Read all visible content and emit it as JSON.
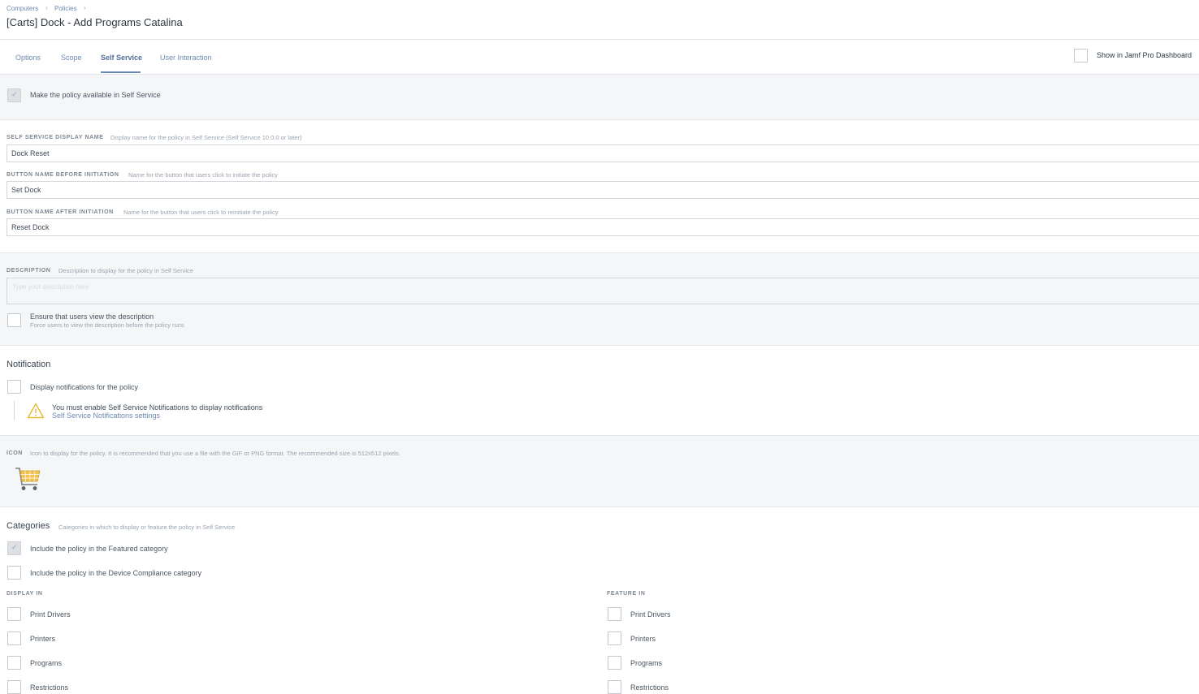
{
  "breadcrumb": {
    "items": [
      "Computers",
      "Policies"
    ],
    "separator": "›"
  },
  "page_title": "[Carts] Dock - Add Programs Catalina",
  "tabs": [
    {
      "label": "Options",
      "active": false
    },
    {
      "label": "Scope",
      "active": false
    },
    {
      "label": "Self Service",
      "active": true
    },
    {
      "label": "User Interaction",
      "active": false
    }
  ],
  "dashboard": {
    "label": "Show in Jamf Pro Dashboard",
    "checked": false
  },
  "availability": {
    "label": "Make the policy available in Self Service",
    "checked": true
  },
  "fields": {
    "display_name": {
      "label": "SELF SERVICE DISPLAY NAME",
      "hint": "Display name for the policy in Self Service (Self Service 10.0.0 or later)",
      "value": "Dock Reset"
    },
    "button_before": {
      "label": "BUTTON NAME BEFORE INITIATION",
      "hint": "Name for the button that users click to initiate the policy",
      "value": "Set Dock"
    },
    "button_after": {
      "label": "BUTTON NAME AFTER INITIATION",
      "hint": "Name for the button that users click to reinitiate the policy",
      "value": "Reset Dock"
    }
  },
  "description": {
    "label": "DESCRIPTION",
    "hint": "Description to display for the policy in Self Service",
    "placeholder": "Type your description here",
    "ensure_label": "Ensure that users view the description",
    "ensure_sub": "Force users to view the description before the policy runs",
    "ensure_checked": false
  },
  "notification": {
    "title": "Notification",
    "display_label": "Display notifications for the policy",
    "display_checked": false,
    "warning_text": "You must enable Self Service Notifications to display notifications",
    "warning_link": "Self Service Notifications settings"
  },
  "icon_section": {
    "label": "ICON",
    "hint": "Icon to display for the policy. It is recommended that you use a file with the GIF or PNG format. The recommended size is 512x512 pixels.",
    "icon": "shopping-cart"
  },
  "categories": {
    "title": "Categories",
    "hint": "Categories in which to display or feature the policy in Self Service",
    "featured_label": "Include the policy in the Featured category",
    "featured_checked": true,
    "compliance_label": "Include the policy in the Device Compliance category",
    "compliance_checked": false,
    "display_in_label": "DISPLAY IN",
    "feature_in_label": "FEATURE IN",
    "display_in": [
      "Print Drivers",
      "Printers",
      "Programs",
      "Restrictions"
    ],
    "feature_in": [
      "Print Drivers",
      "Printers",
      "Programs",
      "Restrictions"
    ]
  },
  "colors": {
    "accent": "#6b8ab1",
    "warning": "#e8b931",
    "band": "#f5f6f8"
  }
}
